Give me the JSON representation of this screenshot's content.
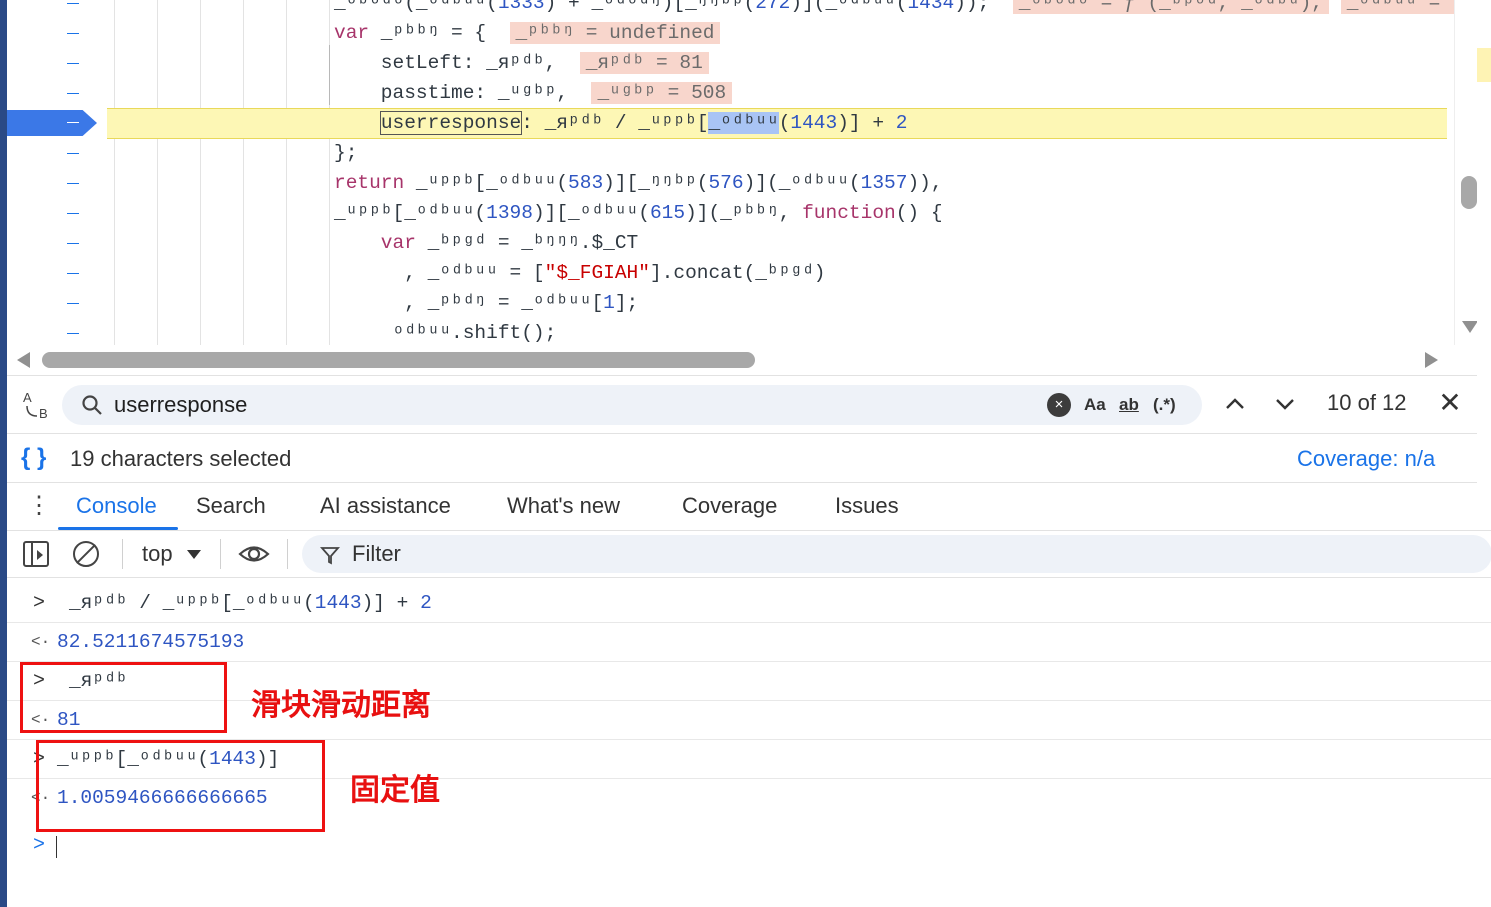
{
  "editor": {
    "lines": [
      {
        "prefix": "_ᵒᵇᵒᵈᵒ(_ᵒᵈᵇᵘᵘ(",
        "num": "1333",
        "rest": ") + _ᵒᵈᵒᵈᵑ)[_ᵑᵑᵇᵖ(",
        "num2": "272",
        "rest2": ")](_ᵒᵈᵇᵘᵘ(",
        "num3": "1434",
        "rest3": "));",
        "val1": "_ᵒᵇᵒᵈᵒ = ƒ (_ᵇᵖᵒᵈ, _ᵒᵈᵇᵘ),",
        "val2": "_ᵒᵈᵇᵘᵘ = ƒ (),"
      },
      {
        "kw": "var",
        "text": " _ᵖᵇᵇᵑ = {  ",
        "inline": "_ᵖᵇᵇᵑ = undefined"
      },
      {
        "text": "    setLeft: _ᴙᵖᵈᵇ,  ",
        "inline": "_ᴙᵖᵈᵇ = 81"
      },
      {
        "text": "    passtime: _ᵘᵍᵇᵖ,  ",
        "inline": "_ᵘᵍᵇᵖ = 508"
      },
      {
        "boxed": "userresponse",
        "text": ": _ᴙᵖᵈᵇ / _ᵘᵖᵖᵇ[",
        "sel": "_ᵒᵈᵇᵘᵘ",
        "num": "1443",
        "tail": ")] + ",
        "num2": "2"
      },
      {
        "text": "};"
      },
      {
        "kw": "return",
        "text": " _ᵘᵖᵖᵇ[_ᵒᵈᵇᵘᵘ(",
        "num": "583",
        "mid": ")][_ᵑᵑᵇᵖ(",
        "num2": "576",
        "mid2": ")](_ᵒᵈᵇᵘᵘ(",
        "num3": "1357",
        "tail": ")),"
      },
      {
        "text": "_ᵘᵖᵖᵇ[_ᵒᵈᵇᵘᵘ(",
        "num": "1398",
        "mid": ")][_ᵒᵈᵇᵘᵘ(",
        "num2": "615",
        "mid2": ")](_ᵖᵇᵇᵑ, ",
        "kw2": "function",
        "tail": "() {"
      },
      {
        "kw": "    var",
        "text": " _ᵇᵖᵍᵈ = _ᵇᵑᵑᵑ.$_CT"
      },
      {
        "text": "      , _ᵒᵈᵇᵘᵘ = [",
        "str": "\"$_FGIAH\"",
        "tail": "].concat(_ᵇᵖᵍᵈ)"
      },
      {
        "text": "      , _ᵖᵇᵈᵑ = _ᵒᵈᵇᵘᵘ[",
        "num": "1",
        "tail": "];"
      },
      {
        "text": "     ᵒᵈᵇᵘᵘ.shift();"
      }
    ]
  },
  "search": {
    "toggle_label": "AB",
    "value": "userresponse",
    "clear_label": "×",
    "match_case": "Aa",
    "whole_word": "ab",
    "regex": "(.*)",
    "prev_label": "⌃",
    "next_label": "⌄",
    "match_count": "10 of 12",
    "close_label": "✕"
  },
  "status": {
    "pretty_print": "{ }",
    "selection": "19 characters selected",
    "coverage": "Coverage: n/a"
  },
  "drawer": {
    "menu": "⋮",
    "tabs": [
      "Console",
      "Search",
      "AI assistance",
      "What's new",
      "Coverage",
      "Issues"
    ]
  },
  "console_toolbar": {
    "context": "top",
    "filter_placeholder": "Filter"
  },
  "console": {
    "entries": [
      {
        "type": "input",
        "text": "_ᴙᵖᵈᵇ / _ᵘᵖᵖᵇ[_ᵒᵈᵇᵘᵘ(",
        "num": "1443",
        "tail": ")] + ",
        "num2": "2"
      },
      {
        "type": "result",
        "text": "82.5211674575193"
      },
      {
        "type": "input",
        "text": "_ᴙᵖᵈᵇ"
      },
      {
        "type": "result",
        "text": "81"
      },
      {
        "type": "input",
        "text": "_ᵘᵖᵖᵇ[_ᵒᵈᵇᵘᵘ(",
        "num": "1443",
        "tail": ")]"
      },
      {
        "type": "result",
        "text": "1.0059466666666665"
      }
    ],
    "prompt_symbol": ">",
    "result_symbol": "<·"
  },
  "annotations": {
    "slider_label": "滑块滑动距离",
    "fixed_label": "固定值",
    "color": "#e81010"
  },
  "colors": {
    "accent": "#1a73e8",
    "exec_line": "#fdf7b5",
    "inline_value": "#f8d6cc"
  }
}
